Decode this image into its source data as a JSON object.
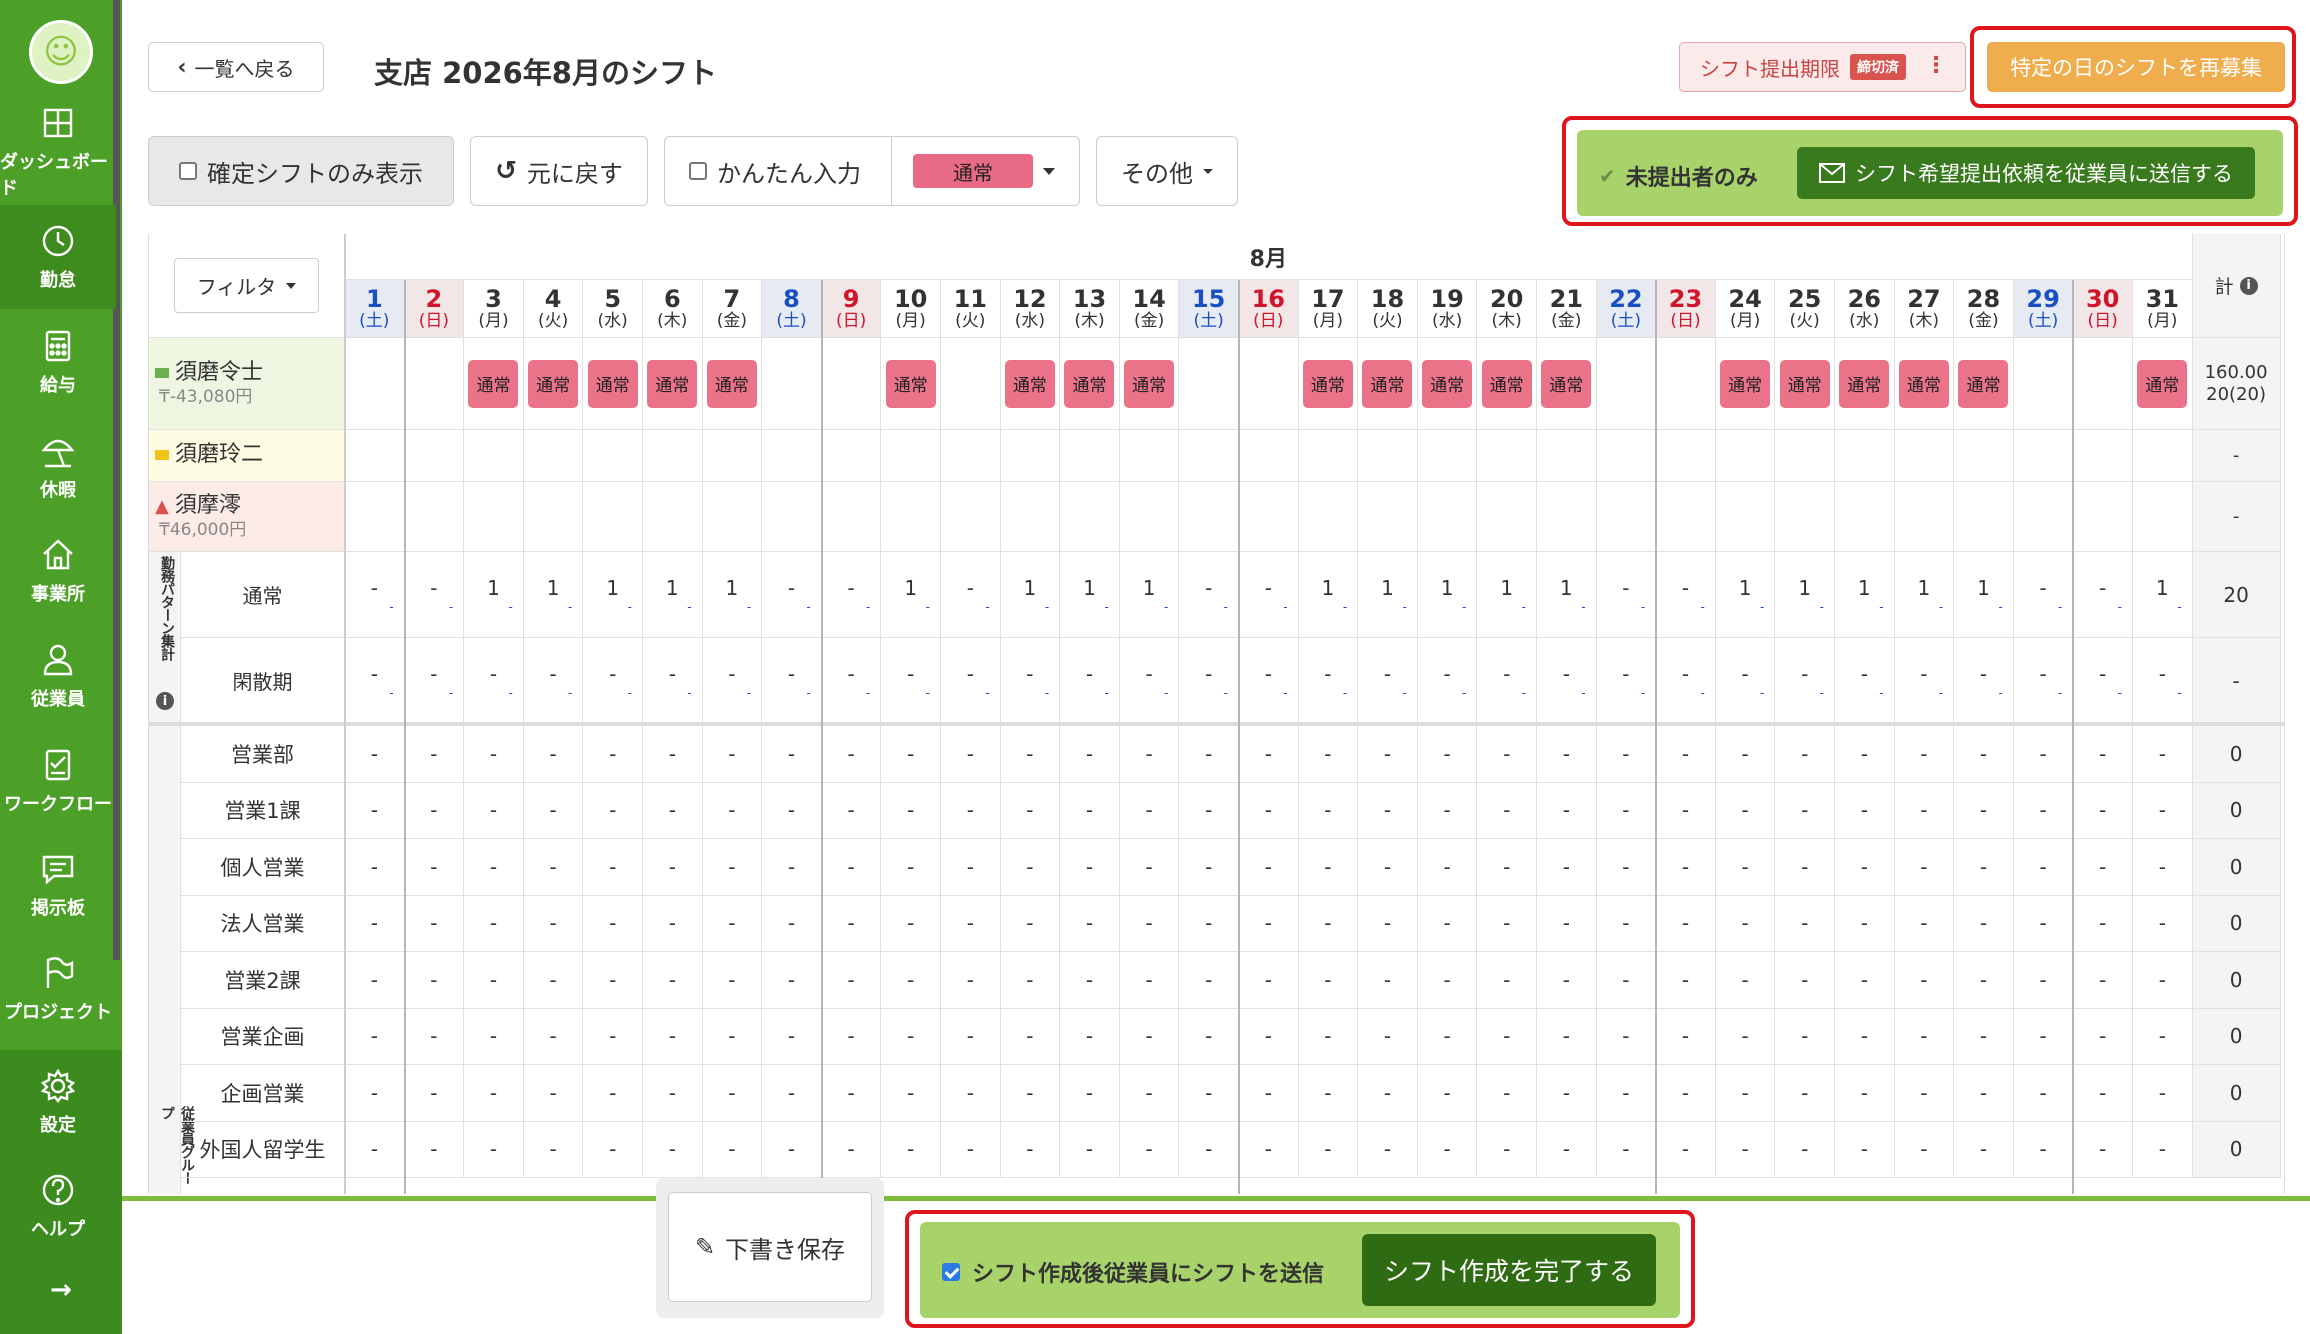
{
  "sidebar": {
    "items": [
      {
        "label": "ダッシュボード",
        "icon": "dashboard-icon"
      },
      {
        "label": "勤怠",
        "icon": "clock-icon"
      },
      {
        "label": "給与",
        "icon": "calculator-icon"
      },
      {
        "label": "休暇",
        "icon": "beach-umbrella-icon"
      },
      {
        "label": "事業所",
        "icon": "home-icon"
      },
      {
        "label": "従業員",
        "icon": "person-icon"
      },
      {
        "label": "ワークフロー",
        "icon": "checklist-icon"
      },
      {
        "label": "掲示板",
        "icon": "message-board-icon"
      },
      {
        "label": "プロジェクト",
        "icon": "flag-icon"
      },
      {
        "label": "設定",
        "icon": "gear-icon"
      },
      {
        "label": "ヘルプ",
        "icon": "help-icon"
      }
    ],
    "expand": "→"
  },
  "header": {
    "back_label": "一覧へ戻る",
    "title": "支店 2026年8月のシフト",
    "deadline_label": "シフト提出期限",
    "deadline_badge": "締切済",
    "rerecruit_label": "特定の日のシフトを再募集"
  },
  "toolbar": {
    "confirmed_only": "確定シフトのみ表示",
    "undo": "元に戻す",
    "easy_input": "かんたん入力",
    "pattern_select": "通常",
    "other": "その他",
    "unsubmitted_only": "未提出者のみ",
    "send_request": "シフト希望提出依頼を従業員に送信する"
  },
  "grid": {
    "filter_label": "フィルタ",
    "month_label": "8月",
    "total_label": "計",
    "days": [
      {
        "d": "1",
        "w": "(土)"
      },
      {
        "d": "2",
        "w": "(日)"
      },
      {
        "d": "3",
        "w": "(月)"
      },
      {
        "d": "4",
        "w": "(火)"
      },
      {
        "d": "5",
        "w": "(水)"
      },
      {
        "d": "6",
        "w": "(木)"
      },
      {
        "d": "7",
        "w": "(金)"
      },
      {
        "d": "8",
        "w": "(土)"
      },
      {
        "d": "9",
        "w": "(日)"
      },
      {
        "d": "10",
        "w": "(月)"
      },
      {
        "d": "11",
        "w": "(火)"
      },
      {
        "d": "12",
        "w": "(水)"
      },
      {
        "d": "13",
        "w": "(木)"
      },
      {
        "d": "14",
        "w": "(金)"
      },
      {
        "d": "15",
        "w": "(土)"
      },
      {
        "d": "16",
        "w": "(日)"
      },
      {
        "d": "17",
        "w": "(月)"
      },
      {
        "d": "18",
        "w": "(火)"
      },
      {
        "d": "19",
        "w": "(水)"
      },
      {
        "d": "20",
        "w": "(木)"
      },
      {
        "d": "21",
        "w": "(金)"
      },
      {
        "d": "22",
        "w": "(土)"
      },
      {
        "d": "23",
        "w": "(日)"
      },
      {
        "d": "24",
        "w": "(月)"
      },
      {
        "d": "25",
        "w": "(火)"
      },
      {
        "d": "26",
        "w": "(水)"
      },
      {
        "d": "27",
        "w": "(木)"
      },
      {
        "d": "28",
        "w": "(金)"
      },
      {
        "d": "29",
        "w": "(土)"
      },
      {
        "d": "30",
        "w": "(日)"
      },
      {
        "d": "31",
        "w": "(月)"
      }
    ],
    "employees": [
      {
        "name": "須磨令士",
        "sub": "₸-43,080円",
        "status": "mail-green",
        "shift_days": [
          3,
          4,
          5,
          6,
          7,
          10,
          12,
          13,
          14,
          17,
          18,
          19,
          20,
          21,
          24,
          25,
          26,
          27,
          28,
          31
        ],
        "total_hours": "160.00",
        "total_days": "20(20)"
      },
      {
        "name": "須磨玲二",
        "sub": "",
        "status": "mail-yellow",
        "shift_days": [],
        "total_hours": "-",
        "total_days": ""
      },
      {
        "name": "須摩澪",
        "sub": "₸46,000円",
        "status": "warning",
        "shift_days": [],
        "total_hours": "-",
        "total_days": ""
      }
    ],
    "shift_label": "通常",
    "pattern_group_label": "勤務パターン集計",
    "patterns": [
      {
        "name": "通常",
        "counts": [
          "-",
          "-",
          "1",
          "1",
          "1",
          "1",
          "1",
          "-",
          "-",
          "1",
          "-",
          "1",
          "1",
          "1",
          "-",
          "-",
          "1",
          "1",
          "1",
          "1",
          "1",
          "-",
          "-",
          "1",
          "1",
          "1",
          "1",
          "1",
          "-",
          "-",
          "1"
        ],
        "total": "20"
      },
      {
        "name": "閑散期",
        "counts": [
          "-",
          "-",
          "-",
          "-",
          "-",
          "-",
          "-",
          "-",
          "-",
          "-",
          "-",
          "-",
          "-",
          "-",
          "-",
          "-",
          "-",
          "-",
          "-",
          "-",
          "-",
          "-",
          "-",
          "-",
          "-",
          "-",
          "-",
          "-",
          "-",
          "-",
          "-"
        ],
        "total": "-"
      }
    ],
    "employee_group_label": "従業員グループ",
    "groups": [
      {
        "name": "営業部",
        "total": "0"
      },
      {
        "name": "営業1課",
        "total": "0"
      },
      {
        "name": "個人営業",
        "total": "0"
      },
      {
        "name": "法人営業",
        "total": "0"
      },
      {
        "name": "営業2課",
        "total": "0"
      },
      {
        "name": "営業企画",
        "total": "0"
      },
      {
        "name": "企画営業",
        "total": "0"
      },
      {
        "name": "外国人留学生",
        "total": "0"
      }
    ]
  },
  "footer": {
    "draft_save": "下書き保存",
    "send_after_create": "シフト作成後従業員にシフトを送信",
    "complete": "シフト作成を完了する"
  },
  "colors": {
    "sidebar_green": "#4c9f27",
    "accent_orange": "#f0ad4e",
    "shift_pink": "#ea7389",
    "saturday_blue": "#1a4fc4",
    "sunday_red": "#d0142c"
  }
}
